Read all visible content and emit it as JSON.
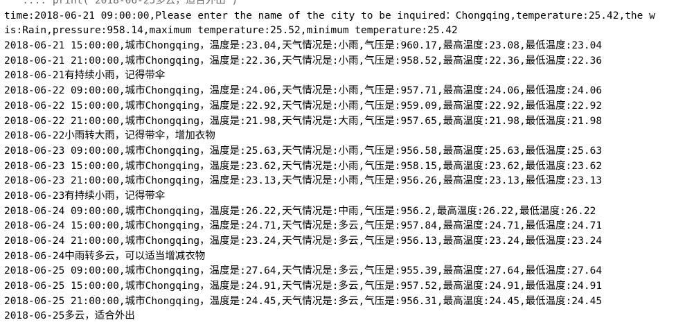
{
  "console": {
    "top_clipped_line": "   .... print('2018-06-25多云，适合外出')",
    "lines": [
      "time:2018-06-21 09:00:00,Please enter the name of the city to be inquired：Chongqing,temperature:25.42,the w",
      "is:Rain,pressure:958.14,maximum temperature:25.52,minimum temperature:25.42",
      "2018-06-21 15:00:00,城市Chongqing，温度是:23.04,天气情况是:小雨,气压是:960.17,最高温度:23.08,最低温度:23.04",
      "2018-06-21 21:00:00,城市Chongqing，温度是:22.36,天气情况是:小雨,气压是:958.52,最高温度:22.36,最低温度:22.36",
      "2018-06-21有持续小雨，记得带伞",
      "2018-06-22 09:00:00,城市Chongqing，温度是:24.06,天气情况是:小雨,气压是:957.71,最高温度:24.06,最低温度:24.06",
      "2018-06-22 15:00:00,城市Chongqing，温度是:22.92,天气情况是:小雨,气压是:959.09,最高温度:22.92,最低温度:22.92",
      "2018-06-22 21:00:00,城市Chongqing，温度是:21.98,天气情况是:大雨,气压是:957.65,最高温度:21.98,最低温度:21.98",
      "2018-06-22小雨转大雨，记得带伞，增加衣物",
      "2018-06-23 09:00:00,城市Chongqing，温度是:25.63,天气情况是:小雨,气压是:956.58,最高温度:25.63,最低温度:25.63",
      "2018-06-23 15:00:00,城市Chongqing，温度是:23.62,天气情况是:小雨,气压是:958.15,最高温度:23.62,最低温度:23.62",
      "2018-06-23 21:00:00,城市Chongqing，温度是:23.13,天气情况是:小雨,气压是:956.26,最高温度:23.13,最低温度:23.13",
      "2018-06-23有持续小雨，记得带伞",
      "2018-06-24 09:00:00,城市Chongqing，温度是:26.22,天气情况是:中雨,气压是:956.2,最高温度:26.22,最低温度:26.22",
      "2018-06-24 15:00:00,城市Chongqing，温度是:24.71,天气情况是:多云,气压是:957.84,最高温度:24.71,最低温度:24.71",
      "2018-06-24 21:00:00,城市Chongqing，温度是:23.24,天气情况是:多云,气压是:956.13,最高温度:23.24,最低温度:23.24",
      "2018-06-24中雨转多云，可以适当增减衣物",
      "2018-06-25 09:00:00,城市Chongqing，温度是:27.64,天气情况是:多云,气压是:955.39,最高温度:27.64,最低温度:27.64",
      "2018-06-25 15:00:00,城市Chongqing，温度是:24.91,天气情况是:多云,气压是:957.52,最高温度:24.91,最低温度:24.91",
      "2018-06-25 21:00:00,城市Chongqing，温度是:24.45,天气情况是:多云,气压是:956.31,最高温度:24.45,最低温度:24.45",
      "2018-06-25多云，适合外出"
    ]
  }
}
